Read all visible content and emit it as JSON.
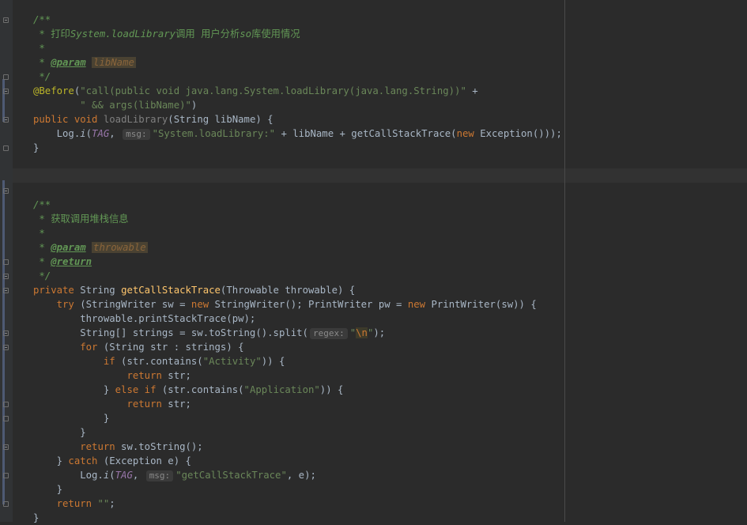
{
  "editor": {
    "lines": [
      [
        {
          "t": "/**",
          "s": "c-doc"
        }
      ],
      [
        {
          "t": " * 打印",
          "s": "c-doc-up"
        },
        {
          "t": "System.loadLibrary",
          "s": "c-doc"
        },
        {
          "t": "调用 用户分析",
          "s": "c-doc-up"
        },
        {
          "t": "so",
          "s": "c-doc"
        },
        {
          "t": "库使用情况",
          "s": "c-doc-up"
        }
      ],
      [
        {
          "t": " *",
          "s": "c-doc"
        }
      ],
      [
        {
          "t": " * ",
          "s": "c-doc"
        },
        {
          "t": "@param",
          "s": "tag"
        },
        {
          "t": " ",
          "s": "c-doc"
        },
        {
          "t": "libName",
          "s": "param-name"
        }
      ],
      [
        {
          "t": " */",
          "s": "c-doc"
        }
      ],
      [
        {
          "t": "@Before",
          "s": "ann"
        },
        {
          "t": "("
        },
        {
          "t": "\"call(public void java.lang.System.loadLibrary(java.lang.String))\"",
          "s": "str"
        },
        {
          "t": " +"
        }
      ],
      [
        {
          "t": "        "
        },
        {
          "t": "\" && args(libName)\"",
          "s": "str"
        },
        {
          "t": ")"
        }
      ],
      [
        {
          "t": "public",
          "s": "kw"
        },
        {
          "t": " "
        },
        {
          "t": "void",
          "s": "kw"
        },
        {
          "t": " "
        },
        {
          "t": "loadLibrary",
          "s": "unused"
        },
        {
          "t": "(String libName) {"
        }
      ],
      [
        {
          "t": "    Log."
        },
        {
          "t": "i",
          "s": "static-call"
        },
        {
          "t": "("
        },
        {
          "t": "TAG",
          "s": "static-field"
        },
        {
          "t": ", "
        },
        {
          "t": "msg:",
          "s": "hint"
        },
        {
          "t": "\"System.loadLibrary:\"",
          "s": "str"
        },
        {
          "t": " + libName + getCallStackTrace("
        },
        {
          "t": "new",
          "s": "kw"
        },
        {
          "t": " Exception()));"
        }
      ],
      [
        {
          "t": "}"
        }
      ],
      [
        {
          "t": ""
        }
      ],
      [
        {
          "t": ""
        }
      ],
      [
        {
          "t": ""
        }
      ],
      [
        {
          "t": "/**",
          "s": "c-doc"
        }
      ],
      [
        {
          "t": " * 获取调用堆栈信息",
          "s": "c-doc-up"
        }
      ],
      [
        {
          "t": " *",
          "s": "c-doc"
        }
      ],
      [
        {
          "t": " * ",
          "s": "c-doc"
        },
        {
          "t": "@param",
          "s": "tag"
        },
        {
          "t": " ",
          "s": "c-doc"
        },
        {
          "t": "throwable",
          "s": "param-name"
        }
      ],
      [
        {
          "t": " * ",
          "s": "c-doc"
        },
        {
          "t": "@return",
          "s": "tag"
        }
      ],
      [
        {
          "t": " */",
          "s": "c-doc"
        }
      ],
      [
        {
          "t": "private",
          "s": "kw"
        },
        {
          "t": " String "
        },
        {
          "t": "getCallStackTrace",
          "s": "fn"
        },
        {
          "t": "(Throwable throwable) {"
        }
      ],
      [
        {
          "t": "    "
        },
        {
          "t": "try",
          "s": "kw"
        },
        {
          "t": " (StringWriter sw = "
        },
        {
          "t": "new",
          "s": "kw"
        },
        {
          "t": " StringWriter(); PrintWriter pw = "
        },
        {
          "t": "new",
          "s": "kw"
        },
        {
          "t": " PrintWriter(sw)) {"
        }
      ],
      [
        {
          "t": "        throwable.printStackTrace(pw);"
        }
      ],
      [
        {
          "t": "        String[] strings = sw.toString().split("
        },
        {
          "t": "regex:",
          "s": "hint"
        },
        {
          "t": "\"",
          "s": "str"
        },
        {
          "t": "\\n",
          "s": "esc"
        },
        {
          "t": "\"",
          "s": "str"
        },
        {
          "t": ");"
        }
      ],
      [
        {
          "t": "        "
        },
        {
          "t": "for",
          "s": "kw"
        },
        {
          "t": " (String str : strings) {"
        }
      ],
      [
        {
          "t": "            "
        },
        {
          "t": "if",
          "s": "kw"
        },
        {
          "t": " (str.contains("
        },
        {
          "t": "\"Activity\"",
          "s": "str"
        },
        {
          "t": ")) {"
        }
      ],
      [
        {
          "t": "                "
        },
        {
          "t": "return",
          "s": "kw"
        },
        {
          "t": " str;"
        }
      ],
      [
        {
          "t": "            } "
        },
        {
          "t": "else if",
          "s": "kw"
        },
        {
          "t": " (str.contains("
        },
        {
          "t": "\"Application\"",
          "s": "str"
        },
        {
          "t": ")) {"
        }
      ],
      [
        {
          "t": "                "
        },
        {
          "t": "return",
          "s": "kw"
        },
        {
          "t": " str;"
        }
      ],
      [
        {
          "t": "            }"
        }
      ],
      [
        {
          "t": "        }"
        }
      ],
      [
        {
          "t": "        "
        },
        {
          "t": "return",
          "s": "kw"
        },
        {
          "t": " sw.toString();"
        }
      ],
      [
        {
          "t": "    } "
        },
        {
          "t": "catch",
          "s": "kw"
        },
        {
          "t": " (Exception e) {"
        }
      ],
      [
        {
          "t": "        Log."
        },
        {
          "t": "i",
          "s": "static-call"
        },
        {
          "t": "("
        },
        {
          "t": "TAG",
          "s": "static-field"
        },
        {
          "t": ", "
        },
        {
          "t": "msg:",
          "s": "hint"
        },
        {
          "t": "\"getCallStackTrace\"",
          "s": "str"
        },
        {
          "t": ", e);"
        }
      ],
      [
        {
          "t": "    }"
        }
      ],
      [
        {
          "t": "    "
        },
        {
          "t": "return",
          "s": "kw"
        },
        {
          "t": " "
        },
        {
          "t": "\"\"",
          "s": "str"
        },
        {
          "t": ";"
        }
      ],
      [
        {
          "t": "}"
        }
      ]
    ]
  }
}
